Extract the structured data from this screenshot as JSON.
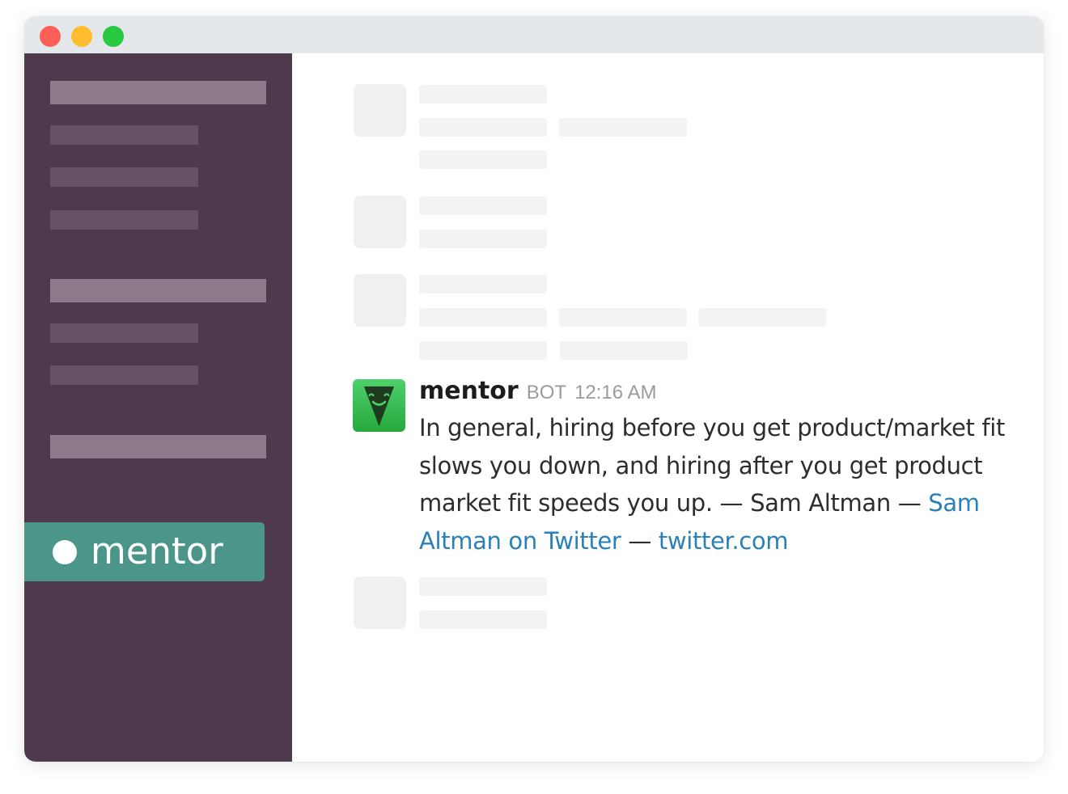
{
  "window": {
    "controls": {
      "close_color": "#fe5f57",
      "minimize_color": "#febc2e",
      "zoom_color": "#28c840"
    }
  },
  "sidebar": {
    "background": "#4e3a4c",
    "active_channel": {
      "label": "mentor",
      "background": "#4c9689"
    }
  },
  "message": {
    "author": "mentor",
    "badge": "BOT",
    "time": "12:16 AM",
    "body_text": "In general, hiring before you get product/market fit slows you down, and hiring after you get product market fit speeds you up. — Sam Altman — ",
    "link_source_label": "Sam Altman on Twitter",
    "separator": " — ",
    "link_site_label": "twitter.com",
    "avatar_icon": "mentor-bot-logo-icon",
    "link_color": "#2a80b9"
  }
}
